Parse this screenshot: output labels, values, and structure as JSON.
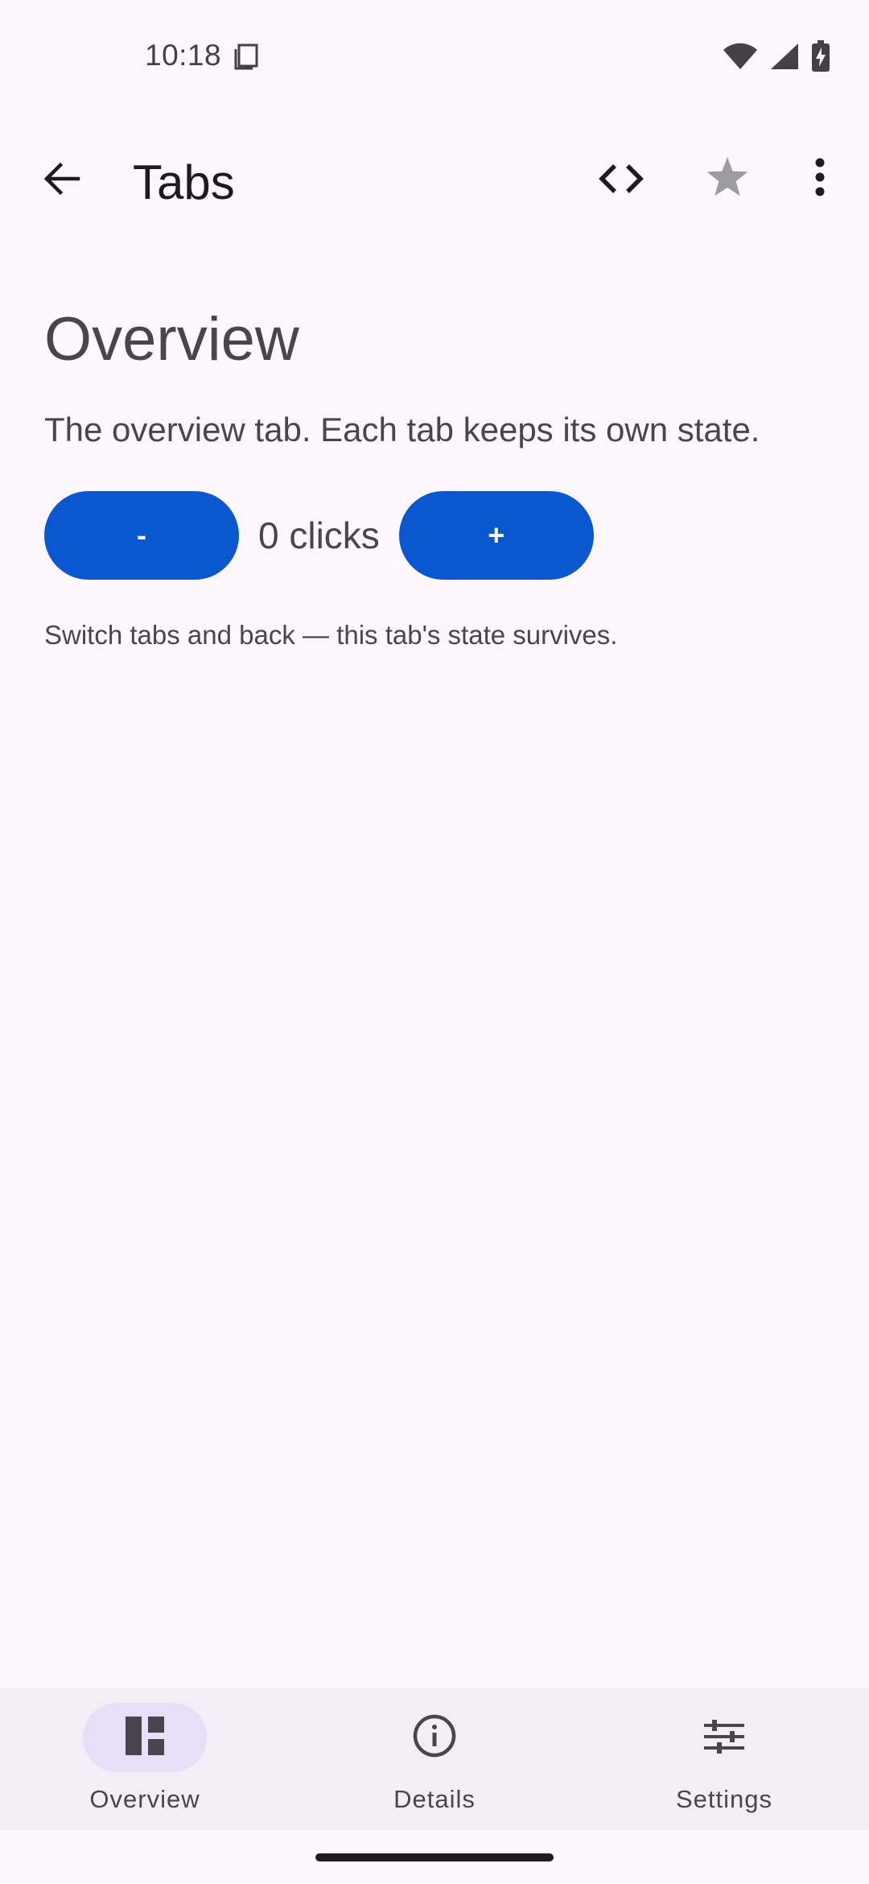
{
  "status_bar": {
    "time": "10:18",
    "icons": [
      "sim-card-icon",
      "wifi-icon",
      "cell-signal-icon",
      "battery-charging-icon"
    ]
  },
  "app_bar": {
    "title": "Tabs",
    "back_icon": "arrow-back-icon",
    "actions": [
      "code-icon",
      "star-icon",
      "more-vert-icon"
    ]
  },
  "content": {
    "title": "Overview",
    "description": "The overview tab. Each tab keeps its own state.",
    "decrement_label": "-",
    "increment_label": "+",
    "counter_text": "0 clicks",
    "hint": "Switch tabs and back — this tab's state survives."
  },
  "bottom_nav": {
    "items": [
      {
        "label": "Overview",
        "icon": "dashboard-icon",
        "active": true
      },
      {
        "label": "Details",
        "icon": "info-icon",
        "active": false
      },
      {
        "label": "Settings",
        "icon": "tune-icon",
        "active": false
      }
    ]
  },
  "colors": {
    "background": "#fdf7fd",
    "primary": "#0b57d0",
    "nav_background": "#f3edf7",
    "nav_indicator": "#e8def8",
    "star": "#9e9ca3",
    "text": "#49454f"
  }
}
